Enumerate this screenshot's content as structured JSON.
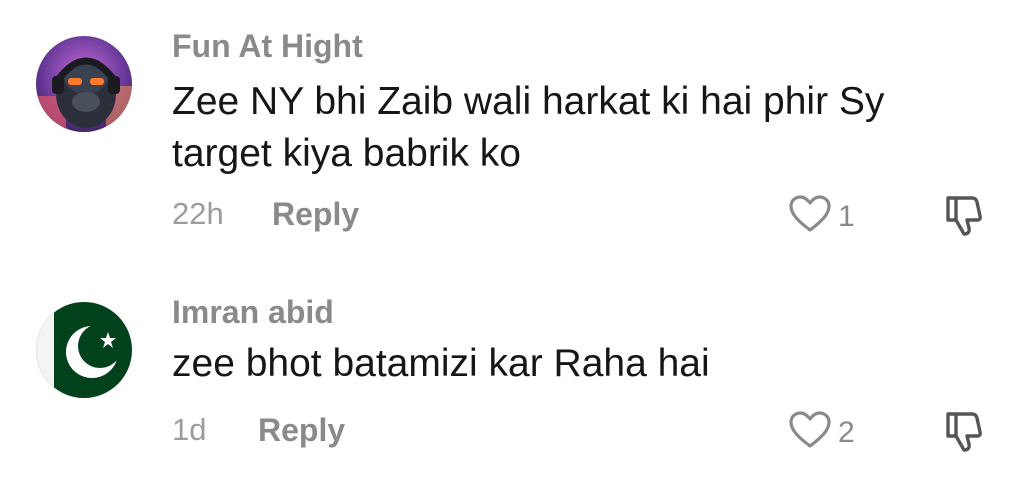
{
  "comments": [
    {
      "username": "Fun At Hight",
      "text": "Zee NY bhi Zaib wali harkat ki hai phir Sy target kiya babrik ko",
      "time": "22h",
      "reply_label": "Reply",
      "likes": "1",
      "avatar_icon": "gorilla-headphones-avatar"
    },
    {
      "username": "Imran abid",
      "text": "zee bhot batamizi kar Raha hai",
      "time": "1d",
      "reply_label": "Reply",
      "likes": "2",
      "avatar_icon": "pakistan-flag-avatar"
    }
  ],
  "icons": {
    "like": "heart-outline-icon",
    "dislike": "thumbs-down-icon"
  },
  "colors": {
    "username": "#8a8a8a",
    "text": "#161616",
    "meta": "#9c9c9c",
    "flag_green": "#01411c"
  }
}
